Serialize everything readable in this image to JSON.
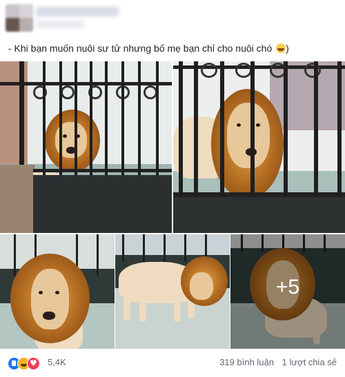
{
  "post": {
    "caption": "- Khi bạn muốn nuôi sư tử nhưng bố mẹ bạn chỉ cho nuôi chó",
    "caption_end": ")",
    "caption_emoji": "grinning-face-icon",
    "more_photos": "+5"
  },
  "footer": {
    "reaction_icons": [
      "like-icon",
      "haha-icon",
      "love-icon"
    ],
    "reaction_count": "5,4K",
    "comments": "319 bình luận",
    "shares": "1 lượt chia sẻ"
  },
  "colors": {
    "like": "#1877f2",
    "haha": "#f7b125",
    "love": "#f33e58",
    "meta_text": "#606770",
    "caption_text": "#1d2129"
  }
}
